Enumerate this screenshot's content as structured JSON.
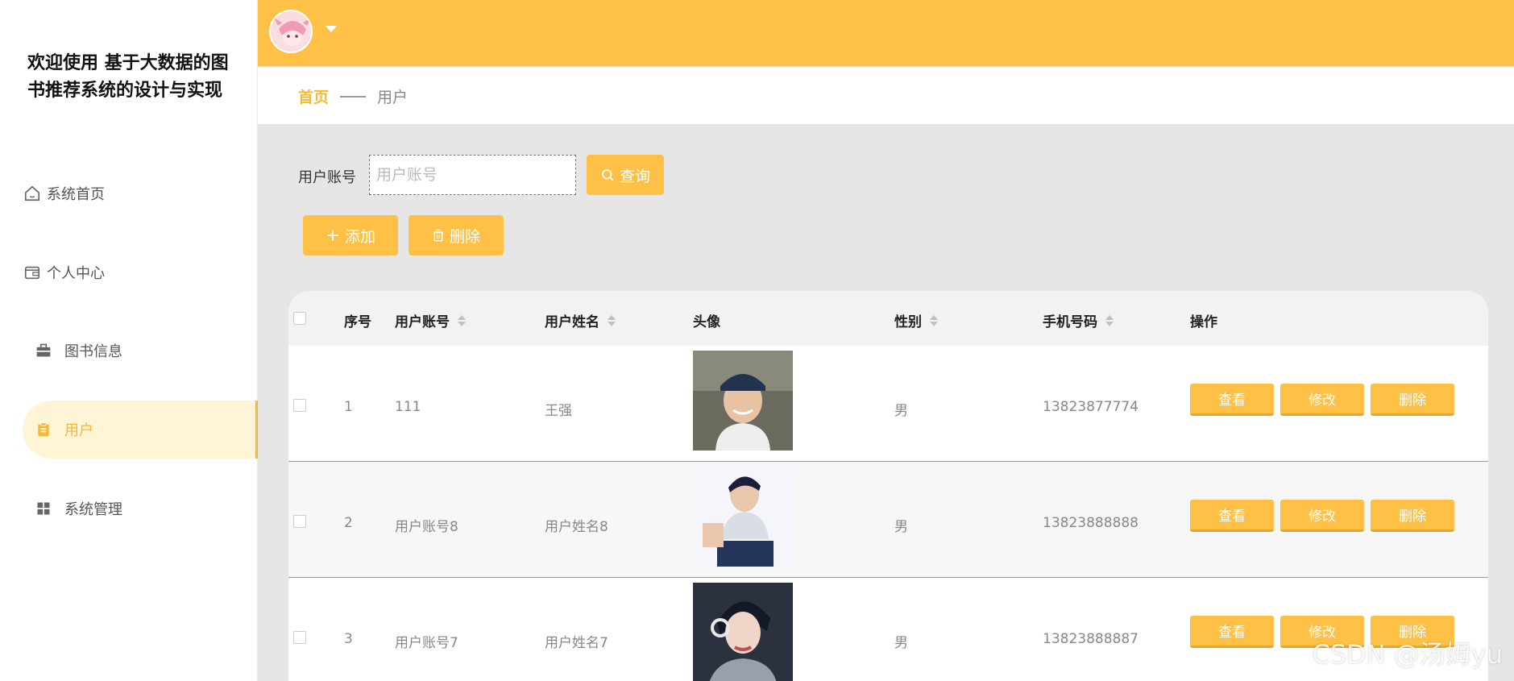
{
  "sidebar": {
    "title": "欢迎使用 基于大数据的图书推荐系统的设计与实现",
    "items": [
      {
        "label": "系统首页",
        "icon": "home-icon"
      },
      {
        "label": "个人中心",
        "icon": "wallet-icon"
      },
      {
        "label": "图书信息",
        "icon": "briefcase-icon"
      },
      {
        "label": "用户",
        "icon": "clipboard-icon",
        "active": true
      },
      {
        "label": "系统管理",
        "icon": "grid-icon"
      }
    ]
  },
  "breadcrumb": {
    "home": "首页",
    "current": "用户"
  },
  "search": {
    "label": "用户账号",
    "placeholder": "用户账号",
    "query_label": "查询"
  },
  "toolbar": {
    "add_label": "添加",
    "delete_label": "删除"
  },
  "table": {
    "headers": [
      "序号",
      "用户账号",
      "用户姓名",
      "头像",
      "性别",
      "手机号码",
      "操作"
    ],
    "rows": [
      {
        "index": "1",
        "account": "111",
        "name": "王强",
        "gender": "男",
        "phone": "13823877774"
      },
      {
        "index": "2",
        "account": "用户账号8",
        "name": "用户姓名8",
        "gender": "男",
        "phone": "13823888888"
      },
      {
        "index": "3",
        "account": "用户账号7",
        "name": "用户姓名7",
        "gender": "男",
        "phone": "13823888887"
      }
    ],
    "actions": {
      "view": "查看",
      "edit": "修改",
      "delete": "删除"
    }
  },
  "watermark": "CSDN @汤姆yu",
  "colors": {
    "accent": "#fec145",
    "accent_text": "#f5b935",
    "active_bg": "#fff4d6"
  }
}
